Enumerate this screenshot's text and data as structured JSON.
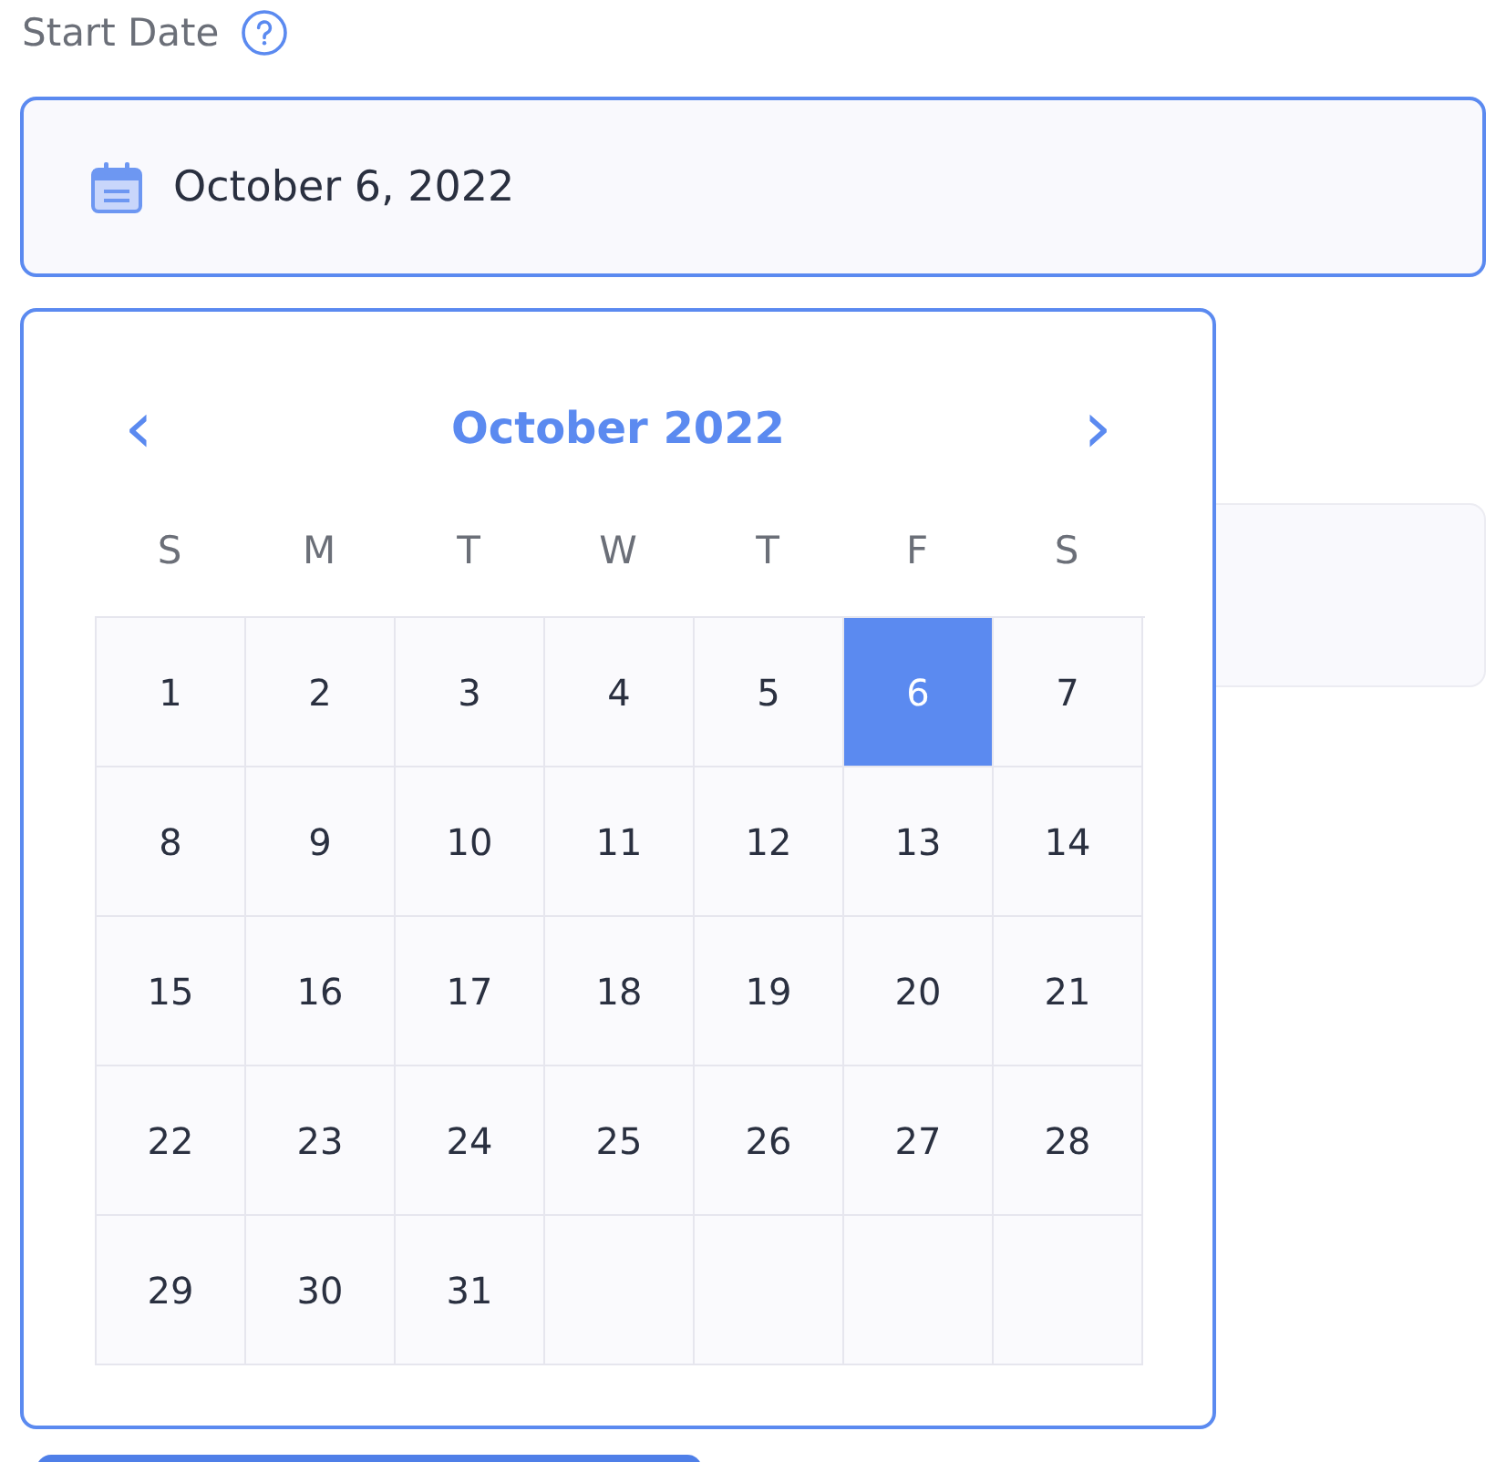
{
  "label": "Start Date",
  "date_field": {
    "value": "October 6, 2022"
  },
  "calendar": {
    "month": "October 2022",
    "prev": "‹",
    "next": "›",
    "weekdays": [
      "S",
      "M",
      "T",
      "W",
      "T",
      "F",
      "S"
    ],
    "days": [
      {
        "day": "1",
        "selected": false
      },
      {
        "day": "2",
        "selected": false
      },
      {
        "day": "3",
        "selected": false
      },
      {
        "day": "4",
        "selected": false
      },
      {
        "day": "5",
        "selected": false
      },
      {
        "day": "6",
        "selected": true
      },
      {
        "day": "7",
        "selected": false
      },
      {
        "day": "8",
        "selected": false
      },
      {
        "day": "9",
        "selected": false
      },
      {
        "day": "10",
        "selected": false
      },
      {
        "day": "11",
        "selected": false
      },
      {
        "day": "12",
        "selected": false
      },
      {
        "day": "13",
        "selected": false
      },
      {
        "day": "14",
        "selected": false
      },
      {
        "day": "15",
        "selected": false
      },
      {
        "day": "16",
        "selected": false
      },
      {
        "day": "17",
        "selected": false
      },
      {
        "day": "18",
        "selected": false
      },
      {
        "day": "19",
        "selected": false
      },
      {
        "day": "20",
        "selected": false
      },
      {
        "day": "21",
        "selected": false
      },
      {
        "day": "22",
        "selected": false
      },
      {
        "day": "23",
        "selected": false
      },
      {
        "day": "24",
        "selected": false
      },
      {
        "day": "25",
        "selected": false
      },
      {
        "day": "26",
        "selected": false
      },
      {
        "day": "27",
        "selected": false
      },
      {
        "day": "28",
        "selected": false
      },
      {
        "day": "29",
        "selected": false
      },
      {
        "day": "30",
        "selected": false
      },
      {
        "day": "31",
        "selected": false
      }
    ]
  }
}
